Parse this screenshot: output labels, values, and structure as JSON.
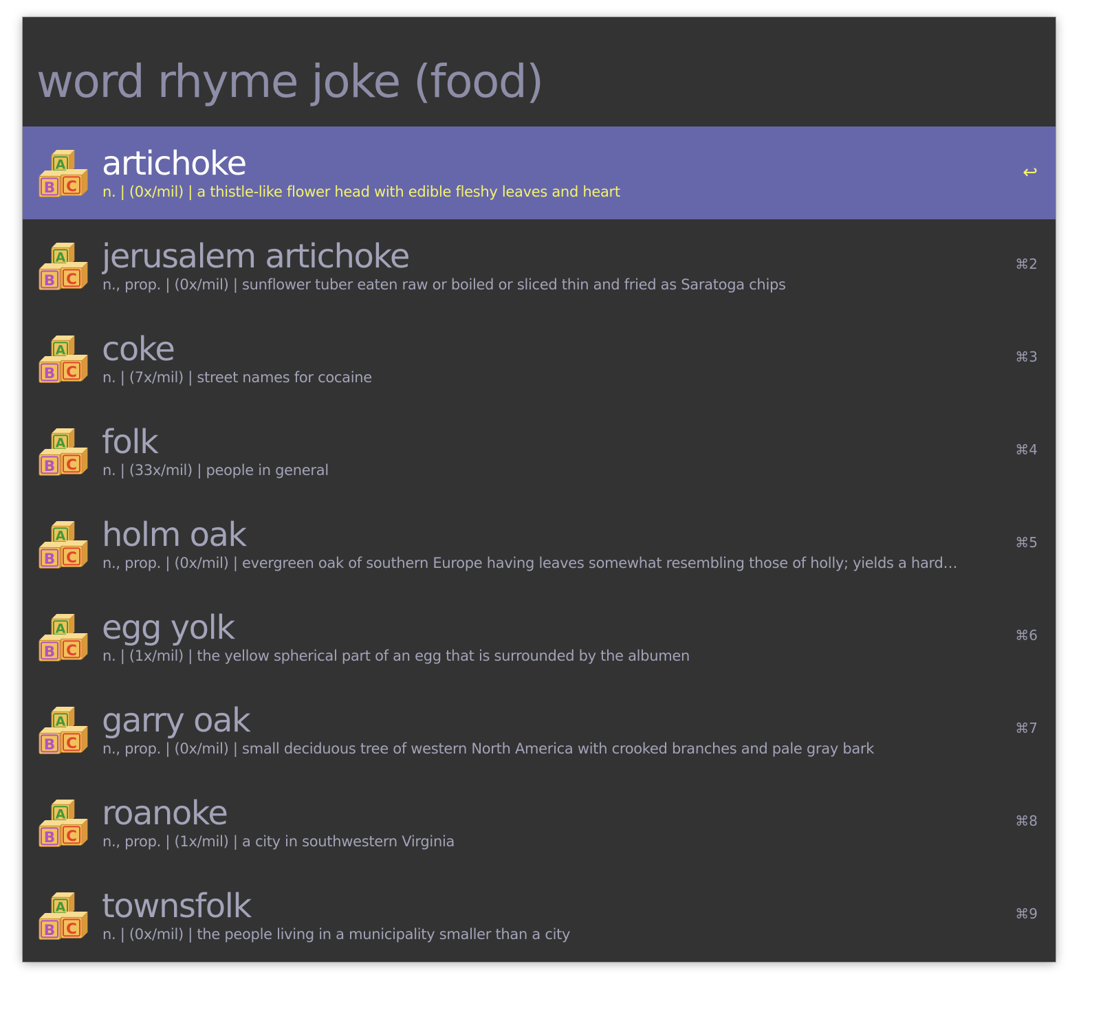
{
  "query": "word rhyme joke (food)",
  "results": [
    {
      "title": "artichoke",
      "subtitle": "n. | (0x/mil) | a thistle-like flower head with edible fleshy leaves and heart",
      "shortcut": "↩",
      "selected": true
    },
    {
      "title": "jerusalem artichoke",
      "subtitle": "n., prop. | (0x/mil) | sunflower tuber eaten raw or boiled or sliced thin and fried as Saratoga chips",
      "shortcut": "⌘2",
      "selected": false
    },
    {
      "title": "coke",
      "subtitle": "n. | (7x/mil) | street names for cocaine",
      "shortcut": "⌘3",
      "selected": false
    },
    {
      "title": "folk",
      "subtitle": "n. | (33x/mil) | people in general",
      "shortcut": "⌘4",
      "selected": false
    },
    {
      "title": "holm oak",
      "subtitle": "n., prop. | (0x/mil) | evergreen oak of southern Europe having leaves somewhat resembling those of holly; yields a hard…",
      "shortcut": "⌘5",
      "selected": false
    },
    {
      "title": "egg yolk",
      "subtitle": "n. | (1x/mil) | the yellow spherical part of an egg that is surrounded by the albumen",
      "shortcut": "⌘6",
      "selected": false
    },
    {
      "title": "garry oak",
      "subtitle": "n., prop. | (0x/mil) | small deciduous tree of western North America with crooked branches and pale gray bark",
      "shortcut": "⌘7",
      "selected": false
    },
    {
      "title": "roanoke",
      "subtitle": "n., prop. | (1x/mil) | a city in southwestern Virginia",
      "shortcut": "⌘8",
      "selected": false
    },
    {
      "title": "townsfolk",
      "subtitle": "n. | (0x/mil) | the people living in a municipality smaller than a city",
      "shortcut": "⌘9",
      "selected": false
    }
  ],
  "icon": {
    "name": "abc-blocks-icon",
    "letters": [
      "A",
      "B",
      "C"
    ],
    "colors": {
      "block_a": "#f2c15c",
      "letter_a": "#3f9a3a",
      "block_b": "#f2c15c",
      "letter_b": "#b053c2",
      "block_c": "#f2c15c",
      "letter_c": "#e0452c"
    }
  },
  "colors": {
    "window_bg": "#333333",
    "selected_bg": "#6667aa",
    "selected_title": "#ffffff",
    "selected_subtitle": "#f4f36b",
    "text": "#a3a3b9",
    "query": "#8d8da8"
  }
}
